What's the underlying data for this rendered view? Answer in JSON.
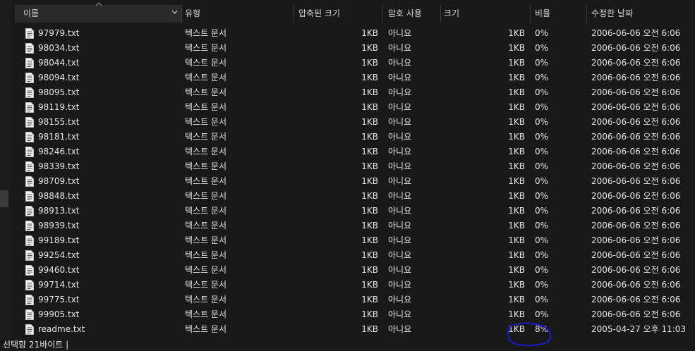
{
  "columns": {
    "name": "이름",
    "type": "유형",
    "compressed": "압축된 크기",
    "password": "암호 사용",
    "size": "크기",
    "ratio": "비율",
    "modified": "수정한 날짜"
  },
  "files": [
    {
      "name": "97979.txt",
      "type": "텍스트 문서",
      "compressed": "1KB",
      "password": "아니요",
      "size": "1KB",
      "ratio": "0%",
      "modified": "2006-06-06 오전 6:06"
    },
    {
      "name": "98034.txt",
      "type": "텍스트 문서",
      "compressed": "1KB",
      "password": "아니요",
      "size": "1KB",
      "ratio": "0%",
      "modified": "2006-06-06 오전 6:06"
    },
    {
      "name": "98044.txt",
      "type": "텍스트 문서",
      "compressed": "1KB",
      "password": "아니요",
      "size": "1KB",
      "ratio": "0%",
      "modified": "2006-06-06 오전 6:06"
    },
    {
      "name": "98094.txt",
      "type": "텍스트 문서",
      "compressed": "1KB",
      "password": "아니요",
      "size": "1KB",
      "ratio": "0%",
      "modified": "2006-06-06 오전 6:06"
    },
    {
      "name": "98095.txt",
      "type": "텍스트 문서",
      "compressed": "1KB",
      "password": "아니요",
      "size": "1KB",
      "ratio": "0%",
      "modified": "2006-06-06 오전 6:06"
    },
    {
      "name": "98119.txt",
      "type": "텍스트 문서",
      "compressed": "1KB",
      "password": "아니요",
      "size": "1KB",
      "ratio": "0%",
      "modified": "2006-06-06 오전 6:06"
    },
    {
      "name": "98155.txt",
      "type": "텍스트 문서",
      "compressed": "1KB",
      "password": "아니요",
      "size": "1KB",
      "ratio": "0%",
      "modified": "2006-06-06 오전 6:06"
    },
    {
      "name": "98181.txt",
      "type": "텍스트 문서",
      "compressed": "1KB",
      "password": "아니요",
      "size": "1KB",
      "ratio": "0%",
      "modified": "2006-06-06 오전 6:06"
    },
    {
      "name": "98246.txt",
      "type": "텍스트 문서",
      "compressed": "1KB",
      "password": "아니요",
      "size": "1KB",
      "ratio": "0%",
      "modified": "2006-06-06 오전 6:06"
    },
    {
      "name": "98339.txt",
      "type": "텍스트 문서",
      "compressed": "1KB",
      "password": "아니요",
      "size": "1KB",
      "ratio": "0%",
      "modified": "2006-06-06 오전 6:06"
    },
    {
      "name": "98709.txt",
      "type": "텍스트 문서",
      "compressed": "1KB",
      "password": "아니요",
      "size": "1KB",
      "ratio": "0%",
      "modified": "2006-06-06 오전 6:06"
    },
    {
      "name": "98848.txt",
      "type": "텍스트 문서",
      "compressed": "1KB",
      "password": "아니요",
      "size": "1KB",
      "ratio": "0%",
      "modified": "2006-06-06 오전 6:06"
    },
    {
      "name": "98913.txt",
      "type": "텍스트 문서",
      "compressed": "1KB",
      "password": "아니요",
      "size": "1KB",
      "ratio": "0%",
      "modified": "2006-06-06 오전 6:06"
    },
    {
      "name": "98939.txt",
      "type": "텍스트 문서",
      "compressed": "1KB",
      "password": "아니요",
      "size": "1KB",
      "ratio": "0%",
      "modified": "2006-06-06 오전 6:06"
    },
    {
      "name": "99189.txt",
      "type": "텍스트 문서",
      "compressed": "1KB",
      "password": "아니요",
      "size": "1KB",
      "ratio": "0%",
      "modified": "2006-06-06 오전 6:06"
    },
    {
      "name": "99254.txt",
      "type": "텍스트 문서",
      "compressed": "1KB",
      "password": "아니요",
      "size": "1KB",
      "ratio": "0%",
      "modified": "2006-06-06 오전 6:06"
    },
    {
      "name": "99460.txt",
      "type": "텍스트 문서",
      "compressed": "1KB",
      "password": "아니요",
      "size": "1KB",
      "ratio": "0%",
      "modified": "2006-06-06 오전 6:06"
    },
    {
      "name": "99714.txt",
      "type": "텍스트 문서",
      "compressed": "1KB",
      "password": "아니요",
      "size": "1KB",
      "ratio": "0%",
      "modified": "2006-06-06 오전 6:06"
    },
    {
      "name": "99775.txt",
      "type": "텍스트 문서",
      "compressed": "1KB",
      "password": "아니요",
      "size": "1KB",
      "ratio": "0%",
      "modified": "2006-06-06 오전 6:06"
    },
    {
      "name": "99905.txt",
      "type": "텍스트 문서",
      "compressed": "1KB",
      "password": "아니요",
      "size": "1KB",
      "ratio": "0%",
      "modified": "2006-06-06 오전 6:06"
    },
    {
      "name": "readme.txt",
      "type": "텍스트 문서",
      "compressed": "1KB",
      "password": "아니요",
      "size": "1KB",
      "ratio": "8%",
      "modified": "2005-04-27 오후 11:03"
    }
  ],
  "status": {
    "text": "선택함 21바이트 |"
  },
  "icons": {
    "file": "text-file-icon",
    "sort": "sort-up-chevron-icon",
    "dropdown": "chevron-down-icon"
  },
  "colors": {
    "background": "#191919",
    "text": "#e6e6e6",
    "annotation": "#1a1ad0"
  }
}
